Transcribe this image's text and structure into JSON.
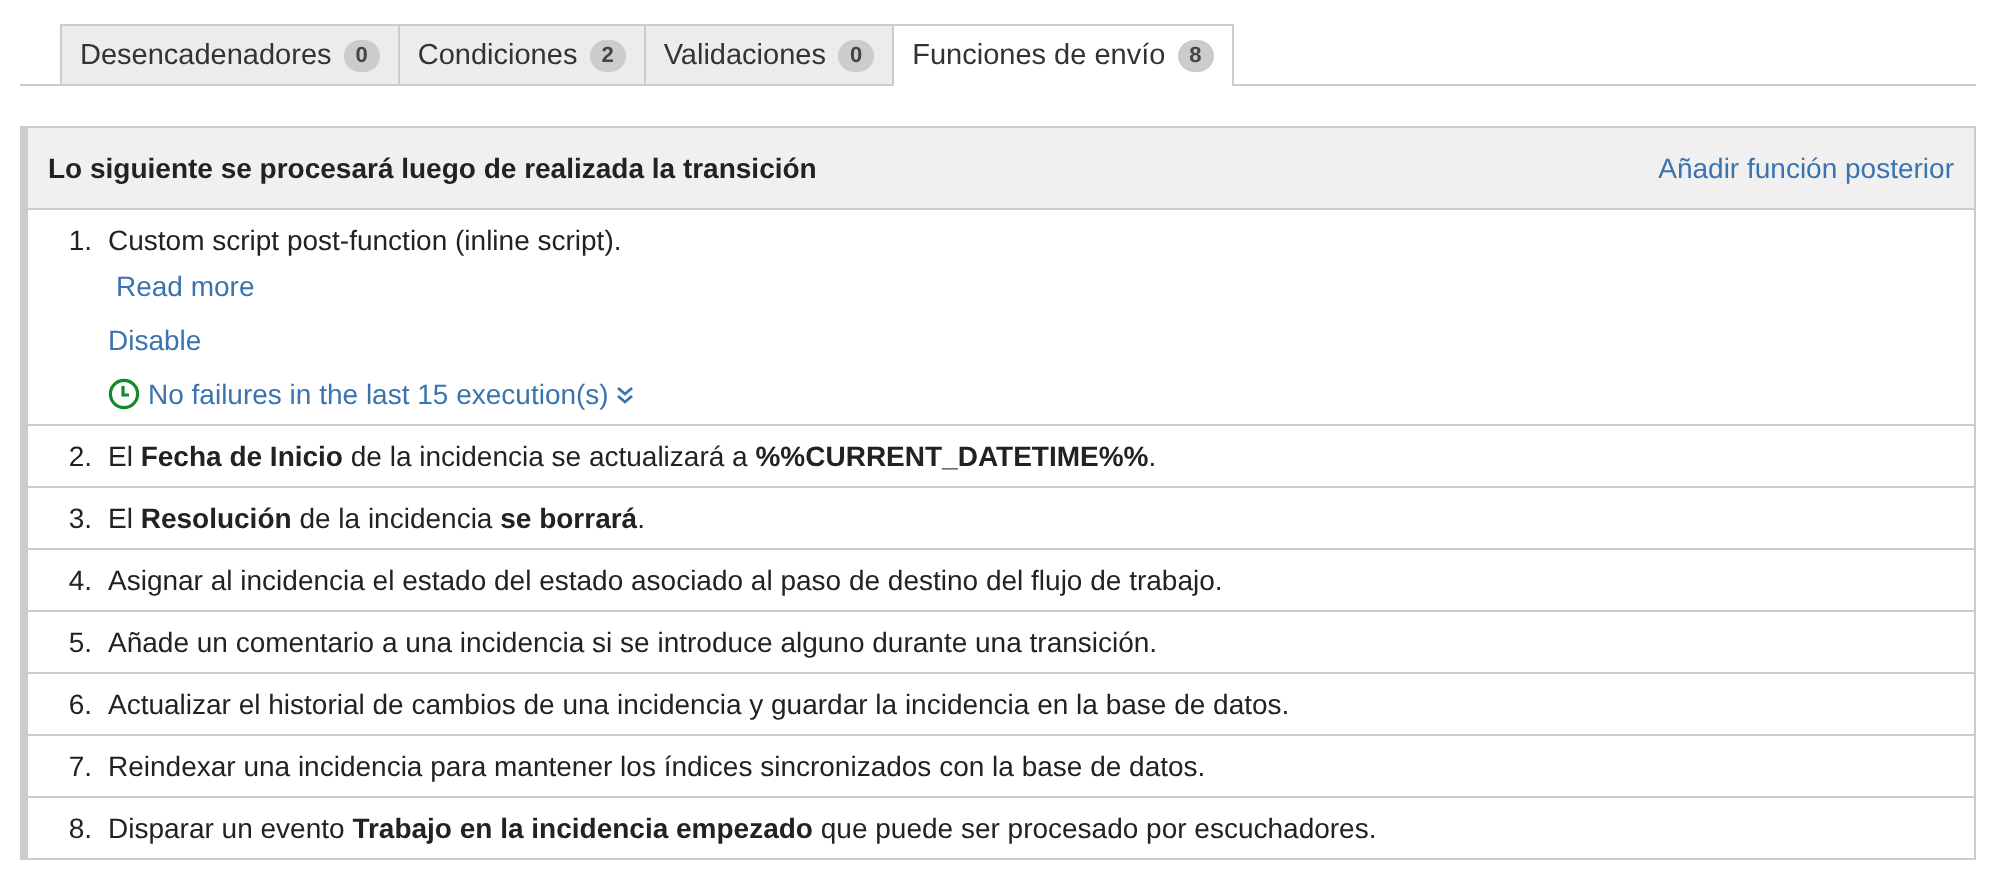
{
  "tabs": [
    {
      "label": "Desencadenadores",
      "count": "0",
      "selected": false
    },
    {
      "label": "Condiciones",
      "count": "2",
      "selected": false
    },
    {
      "label": "Validaciones",
      "count": "0",
      "selected": false
    },
    {
      "label": "Funciones de envío",
      "count": "8",
      "selected": true
    }
  ],
  "panel": {
    "title": "Lo siguiente se procesará luego de realizada la transición",
    "action": "Añadir función posterior",
    "items": [
      {
        "kind": "script",
        "number": "1.",
        "text": "Custom script post-function (inline script).",
        "read_more": "Read more",
        "disable": "Disable",
        "status": "No failures in the last 15 execution(s)"
      },
      {
        "kind": "plain",
        "number": "2.",
        "text": "El **Fecha de Inicio** de la incidencia se actualizará a **%%CURRENT_DATETIME%%**."
      },
      {
        "kind": "plain",
        "number": "3.",
        "text": "El **Resolución** de la incidencia **se borrará**."
      },
      {
        "kind": "plain",
        "number": "4.",
        "text": "Asignar al incidencia el estado del estado asociado al paso de destino del flujo de trabajo."
      },
      {
        "kind": "plain",
        "number": "5.",
        "text": "Añade un comentario a una incidencia si se introduce alguno durante una transición."
      },
      {
        "kind": "plain",
        "number": "6.",
        "text": "Actualizar el historial de cambios de una incidencia y guardar la incidencia en la base de datos."
      },
      {
        "kind": "plain",
        "number": "7.",
        "text": "Reindexar una incidencia para mantener los índices sincronizados con la base de datos."
      },
      {
        "kind": "plain",
        "number": "8.",
        "text": "Disparar un evento **Trabajo en la incidencia empezado** que puede ser procesado por escuchadores."
      }
    ]
  }
}
